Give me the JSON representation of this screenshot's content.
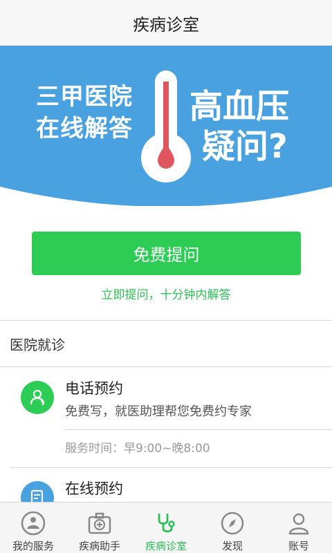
{
  "header": {
    "title": "疾病诊室"
  },
  "banner": {
    "left_line1": "三甲医院",
    "left_line2": "在线解答",
    "right_line1": "高血压",
    "right_line2": "疑问?"
  },
  "ask": {
    "button_label": "免费提问",
    "subtitle": "立即提问，十分钟内解答"
  },
  "section": {
    "title": "医院就诊"
  },
  "services": [
    {
      "title": "电话预约",
      "desc": "免费写，就医助理帮您免费约专家",
      "time": "服务时间：早9:00~晚8:00",
      "icon": "phone-doctor-icon"
    },
    {
      "title": "在线预约",
      "icon": "online-appointment-icon"
    }
  ],
  "tabs": [
    {
      "label": "我的服务",
      "icon": "my-service-icon"
    },
    {
      "label": "疾病助手",
      "icon": "medical-kit-icon"
    },
    {
      "label": "疾病诊室",
      "icon": "stethoscope-icon"
    },
    {
      "label": "发现",
      "icon": "compass-icon"
    },
    {
      "label": "账号",
      "icon": "user-icon"
    }
  ],
  "colors": {
    "banner_blue": "#4aa1e0",
    "accent_green": "#2dcc55"
  }
}
